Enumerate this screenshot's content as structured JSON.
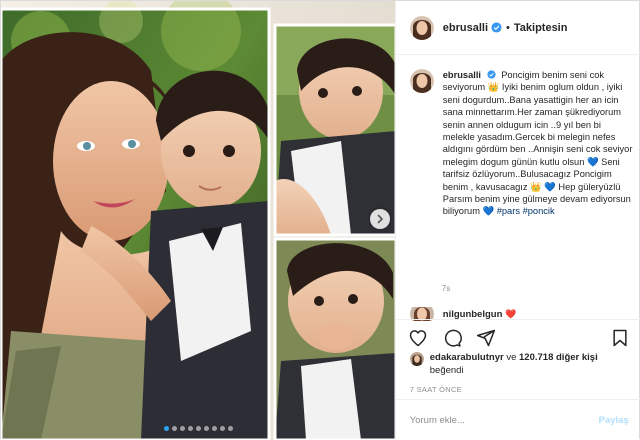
{
  "post": {
    "username": "ebrusalli",
    "separator": "•",
    "follow_label": "Takiptesin",
    "caption_user": "ebrusalli",
    "caption_text": "Poncigim benim seni cok seviyorum 👑 Iyiki benim oglum oldun , iyiki seni dogurdum..Bana yasattigin her an icin sana minnettarım.Her zaman şükrediyorum senin annen oldugum icin ..9 yıl ben bi melekle yasadım.Gercek bi melegin nefes aldıgını gördüm ben ..Annişin seni cok seviyor melegim dogum günün kutlu olsun 💙 Seni tarifsiz özlüyorum..Bulusacagız Poncigim benim , kavusacagız 👑 💙 Hep güleryüzlü Parsım benim yine gülmeye devam ediyorsun biliyorum 💙",
    "hashtags": [
      "#pars",
      "#poncik"
    ],
    "time_short": "7s",
    "comment_user": "nilgunbelgun",
    "comment_emoji": "❤️",
    "likes_user": "edakarabulutnyr",
    "likes_joiner": "ve",
    "likes_count": "120.718 diğer kişi",
    "likes_suffix": "beğendi",
    "time_ago": "7 SAAT ÖNCE",
    "comment_placeholder": "Yorum ekle...",
    "post_button": "Paylaş",
    "verified_color": "#3897f0",
    "heart_color": "#ed4956"
  },
  "carousel": {
    "slide_count": 9,
    "active_index": 0
  },
  "icons": {
    "like": "heart-icon",
    "comment": "comment-icon",
    "share": "share-icon",
    "save": "bookmark-icon",
    "next": "chevron-right-icon"
  }
}
